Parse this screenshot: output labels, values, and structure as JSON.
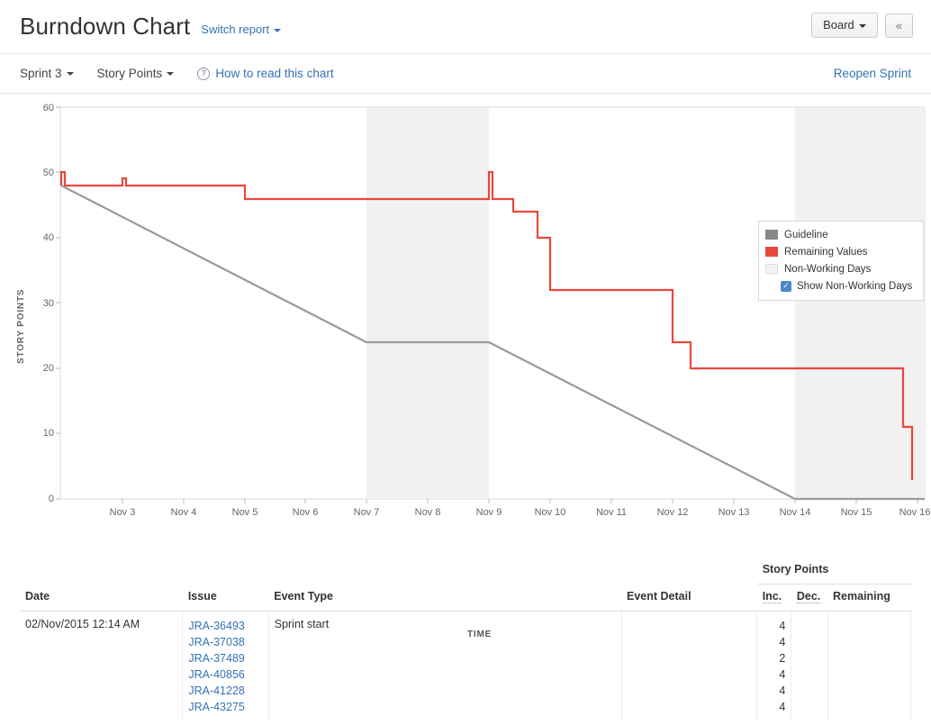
{
  "header": {
    "title": "Burndown Chart",
    "switch_report": "Switch report",
    "board_button": "Board",
    "collapse_icon": "«"
  },
  "subnav": {
    "sprint": "Sprint 3",
    "metric": "Story Points",
    "help": "How to read this chart",
    "reopen": "Reopen Sprint"
  },
  "legend": {
    "guideline": "Guideline",
    "remaining": "Remaining Values",
    "nonworking": "Non-Working Days",
    "show_nonworking": "Show Non-Working Days",
    "checkbox_checked": true,
    "check_glyph": "✓"
  },
  "colors": {
    "remaining": "#e8483c",
    "guideline": "#9a9a9a",
    "nonworking": "#f2f2f2",
    "link": "#3572b0",
    "checkbox": "#4c87c7"
  },
  "chart_data": {
    "type": "line",
    "title": "Burndown Chart",
    "xlabel": "TIME",
    "ylabel": "STORY POINTS",
    "ylim": [
      0,
      60
    ],
    "yticks": [
      0,
      10,
      20,
      30,
      40,
      50,
      60
    ],
    "xticks": [
      "Nov 3",
      "Nov 4",
      "Nov 5",
      "Nov 6",
      "Nov 7",
      "Nov 8",
      "Nov 9",
      "Nov 10",
      "Nov 11",
      "Nov 12",
      "Nov 13",
      "Nov 14",
      "Nov 15",
      "Nov 16"
    ],
    "xlim": [
      "Nov 2",
      "Nov 16"
    ],
    "grid": false,
    "legend_position": "top-right",
    "series": [
      {
        "name": "Remaining Values",
        "type": "step",
        "color": "#e8483c",
        "points": [
          {
            "x": "Nov 2.00",
            "y": 48
          },
          {
            "x": "Nov 2.15",
            "y": 50
          },
          {
            "x": "Nov 2.15",
            "y": 48
          },
          {
            "x": "Nov 3.10",
            "y": 48
          },
          {
            "x": "Nov 3.10",
            "y": 49
          },
          {
            "x": "Nov 3.10",
            "y": 48
          },
          {
            "x": "Nov 5.12",
            "y": 48
          },
          {
            "x": "Nov 5.12",
            "y": 46
          },
          {
            "x": "Nov 9.05",
            "y": 46
          },
          {
            "x": "Nov 9.05",
            "y": 48
          },
          {
            "x": "Nov 9.05",
            "y": 46
          },
          {
            "x": "Nov 9.45",
            "y": 46
          },
          {
            "x": "Nov 9.45",
            "y": 44
          },
          {
            "x": "Nov 10.05",
            "y": 44
          },
          {
            "x": "Nov 10.05",
            "y": 40
          },
          {
            "x": "Nov 10.45",
            "y": 40
          },
          {
            "x": "Nov 10.45",
            "y": 32
          },
          {
            "x": "Nov 12.50",
            "y": 32
          },
          {
            "x": "Nov 12.50",
            "y": 24
          },
          {
            "x": "Nov 12.75",
            "y": 24
          },
          {
            "x": "Nov 12.75",
            "y": 20
          },
          {
            "x": "Nov 15.80",
            "y": 20
          },
          {
            "x": "Nov 15.80",
            "y": 11
          },
          {
            "x": "Nov 15.95",
            "y": 11
          },
          {
            "x": "Nov 15.95",
            "y": 3
          }
        ]
      },
      {
        "name": "Guideline",
        "type": "line",
        "color": "#9a9a9a",
        "points": [
          {
            "x": "Nov 2",
            "y": 48
          },
          {
            "x": "Nov 7",
            "y": 24
          },
          {
            "x": "Nov 9",
            "y": 24
          },
          {
            "x": "Nov 14",
            "y": 0
          },
          {
            "x": "Nov 16",
            "y": 0
          }
        ]
      }
    ],
    "nonworking_bands": [
      {
        "start": "Nov 7",
        "end": "Nov 9"
      },
      {
        "start": "Nov 14",
        "end": "Nov 16"
      }
    ]
  },
  "table": {
    "group_header": "Story Points",
    "columns": [
      "Date",
      "Issue",
      "Event Type",
      "Event Detail",
      "Inc.",
      "Dec.",
      "Remaining"
    ],
    "rows": [
      {
        "date": "02/Nov/2015 12:14 AM",
        "issues": [
          "JRA-36493",
          "JRA-37038",
          "JRA-37489",
          "JRA-40856",
          "JRA-41228",
          "JRA-43275"
        ],
        "event_type": "Sprint start",
        "event_detail": "",
        "inc": [
          "4",
          "4",
          "2",
          "4",
          "4",
          "4"
        ],
        "dec": [],
        "remaining": ""
      }
    ]
  }
}
